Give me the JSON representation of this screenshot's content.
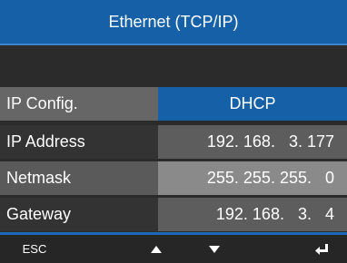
{
  "header": {
    "title": "Ethernet (TCP/IP)"
  },
  "rows": [
    {
      "label": "IP Config.",
      "value": "DHCP"
    },
    {
      "label": "IP Address",
      "value": "192. 168.   3. 177"
    },
    {
      "label": "Netmask",
      "value": "255. 255. 255.   0"
    },
    {
      "label": "Gateway",
      "value": "192. 168.   3.   4"
    }
  ],
  "footer": {
    "esc_label": "ESC",
    "up_icon": "triangle-up-icon",
    "down_icon": "triangle-down-icon",
    "enter_icon": "enter-return-icon"
  },
  "colors": {
    "accent": "#1560a6",
    "background": "#2b2b2b",
    "footer": "#262626"
  }
}
